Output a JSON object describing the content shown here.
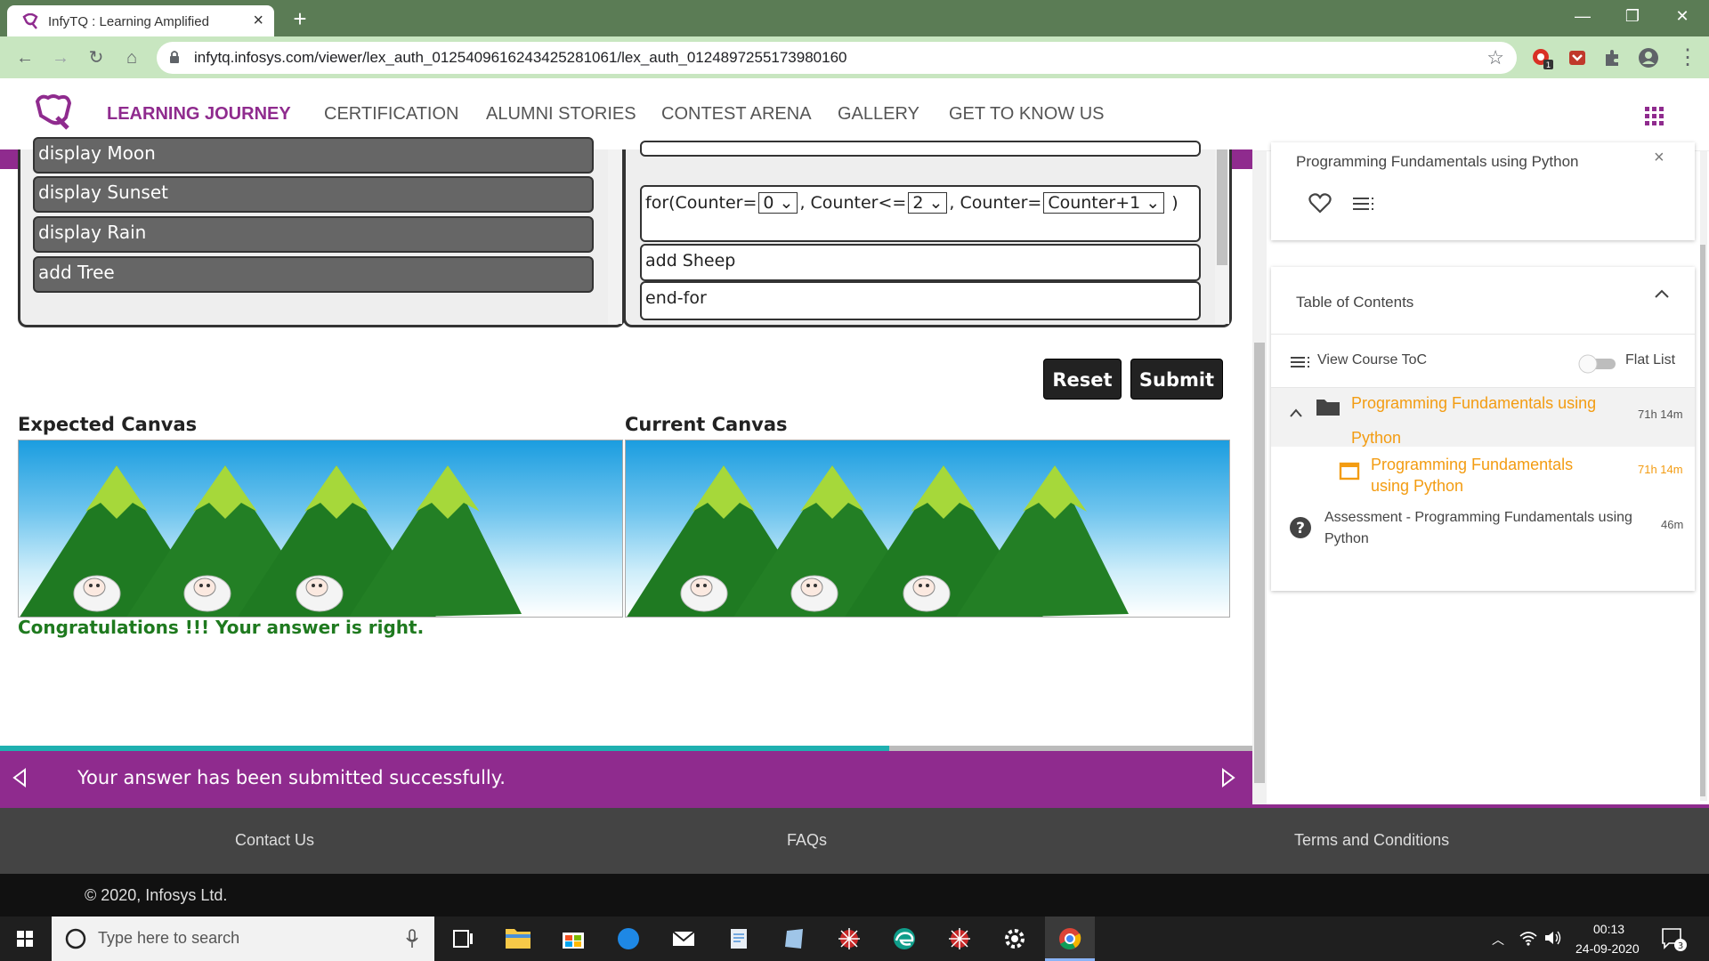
{
  "browser": {
    "tab_title": "InfyTQ : Learning Amplified",
    "url": "infytq.infosys.com/viewer/lex_auth_01254096162434252810​61/lex_auth_0124897255173980160",
    "ext_badge": "1"
  },
  "site_nav": {
    "items": [
      "LEARNING JOURNEY",
      "CERTIFICATION",
      "ALUMNI STORIES",
      "CONTEST ARENA",
      "GALLERY",
      "GET TO KNOW US"
    ],
    "active_color": "#8f2b8e"
  },
  "left_blocks": [
    "display Moon",
    "display Sunset",
    "display Rain",
    "add Tree"
  ],
  "right_blocks": {
    "for_prefix": "for(Counter=",
    "start_value": "0",
    "cond_label": ", Counter<=",
    "end_value": "2",
    "step_label": ", Counter=",
    "step_value": "Counter+1",
    "for_suffix": " )",
    "line2": "add Sheep",
    "line3": "end-for"
  },
  "buttons": {
    "reset": "Reset",
    "submit": "Submit"
  },
  "canvases": {
    "expected_label": "Expected Canvas",
    "current_label": "Current Canvas"
  },
  "result_message": "Congratulations !!! Your answer is right.",
  "progress": {
    "fraction": 0.71
  },
  "status_message": "Your answer has been submitted successfully.",
  "sidebar": {
    "course_title": "Programming Fundamentals using Python",
    "toc_title": "Table of Contents",
    "view_toc": "View Course ToC",
    "flat_list": "Flat List",
    "items": [
      {
        "title_line1": "Programming Fundamentals using",
        "title_line2": "Python",
        "duration": "71h 14m"
      },
      {
        "title_line1": "Programming Fundamentals",
        "title_line2": "using Python",
        "duration": "71h 14m"
      },
      {
        "title_line1": "Assessment - Programming Fundamentals using",
        "title_line2": "Python",
        "duration": "46m"
      }
    ],
    "accent_color": "#f39c12"
  },
  "footer": {
    "contact": "Contact Us",
    "faqs": "FAQs",
    "terms": "Terms and Conditions",
    "copyright": "© 2020, Infosys Ltd."
  },
  "taskbar": {
    "search_placeholder": "Type here to search",
    "time": "00:13",
    "date": "24-09-2020",
    "notification_count": "3"
  }
}
